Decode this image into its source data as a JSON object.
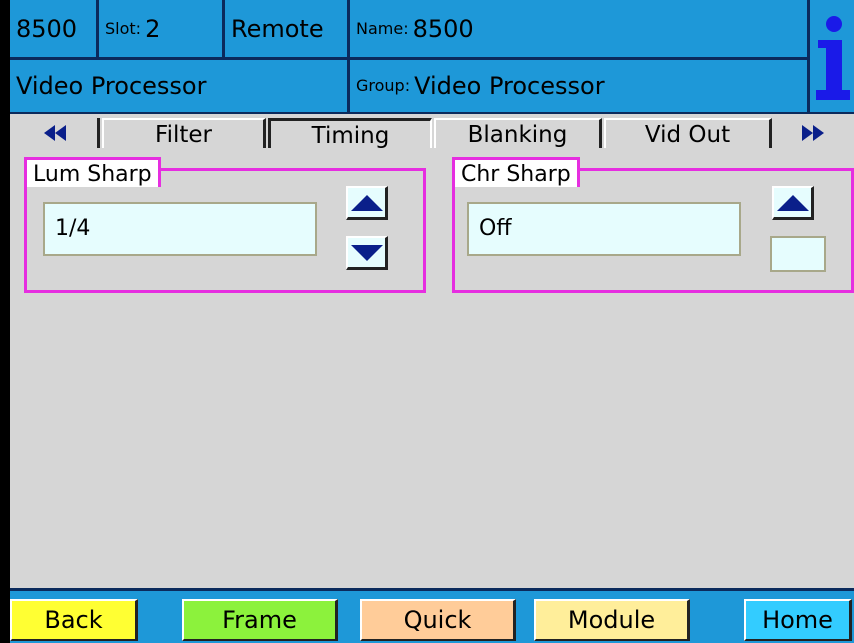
{
  "header": {
    "model": "8500",
    "slot_label": "Slot:",
    "slot_value": "2",
    "mode": "Remote",
    "name_label": "Name:",
    "name_value": "8500",
    "device_type": "Video Processor",
    "group_label": "Group:",
    "group_value": "Video Processor",
    "info_icon": "info-icon",
    "info_text": "i",
    "colors": {
      "bar": "#1e98d8",
      "icon": "#1a1ae8"
    }
  },
  "tabs": {
    "prev_icon": "double-left-arrow-icon",
    "next_icon": "double-right-arrow-icon",
    "items": [
      {
        "label": "Filter",
        "selected": false
      },
      {
        "label": "Timing",
        "selected": true
      },
      {
        "label": "Blanking",
        "selected": false
      },
      {
        "label": "Vid Out",
        "selected": false
      }
    ]
  },
  "panels": {
    "lum_sharp": {
      "label": "Lum Sharp",
      "value": "1/4",
      "up_icon": "up-arrow-icon",
      "down_icon": "down-arrow-icon"
    },
    "chr_sharp": {
      "label": "Chr Sharp",
      "value": "Off",
      "up_icon": "up-arrow-icon"
    },
    "border_color": "#e62ee0",
    "field_color": "#e6fdfe"
  },
  "bottom": {
    "buttons": [
      {
        "label": "Back",
        "color": "#ffff33"
      },
      {
        "label": "Frame",
        "color": "#8cf23c"
      },
      {
        "label": "Quick",
        "color": "#ffcc99"
      },
      {
        "label": "Module",
        "color": "#ffee9a"
      },
      {
        "label": "Home",
        "color": "#33ccff"
      }
    ]
  }
}
